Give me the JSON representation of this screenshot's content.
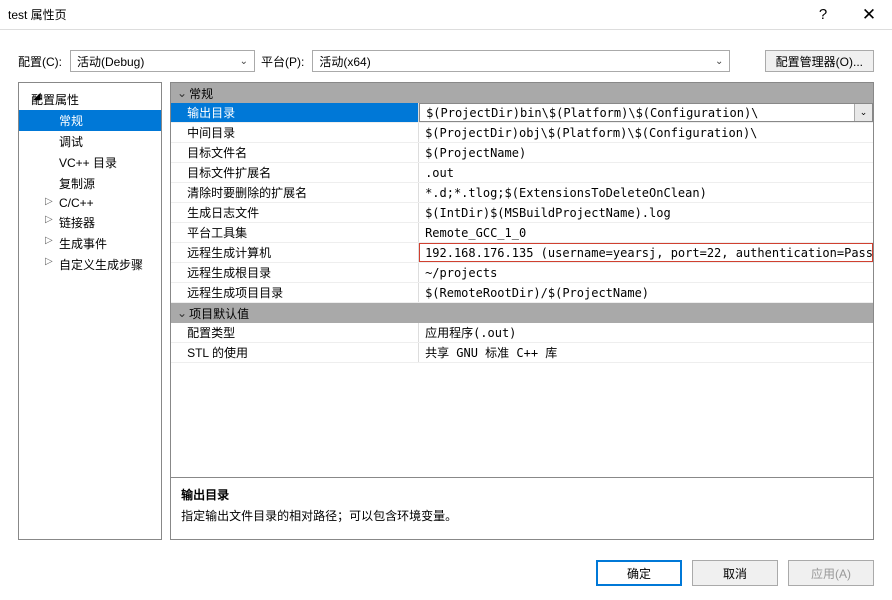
{
  "title": "test 属性页",
  "toprow": {
    "config_label": "配置(C):",
    "config_value": "活动(Debug)",
    "platform_label": "平台(P):",
    "platform_value": "活动(x64)",
    "config_mgr": "配置管理器(O)..."
  },
  "tree": [
    {
      "label": "配置属性",
      "level": 0,
      "arrow": "open"
    },
    {
      "label": "常规",
      "level": 1,
      "selected": true
    },
    {
      "label": "调试",
      "level": 1
    },
    {
      "label": "VC++ 目录",
      "level": 1
    },
    {
      "label": "复制源",
      "level": 1
    },
    {
      "label": "C/C++",
      "level": 1,
      "arrow": "closed"
    },
    {
      "label": "链接器",
      "level": 1,
      "arrow": "closed"
    },
    {
      "label": "生成事件",
      "level": 1,
      "arrow": "closed"
    },
    {
      "label": "自定义生成步骤",
      "level": 1,
      "arrow": "closed"
    }
  ],
  "grid": {
    "sections": [
      {
        "header": "常规",
        "rows": [
          {
            "name": "输出目录",
            "value": "$(ProjectDir)bin\\$(Platform)\\$(Configuration)\\",
            "hl": true
          },
          {
            "name": "中间目录",
            "value": "$(ProjectDir)obj\\$(Platform)\\$(Configuration)\\"
          },
          {
            "name": "目标文件名",
            "value": "$(ProjectName)"
          },
          {
            "name": "目标文件扩展名",
            "value": ".out"
          },
          {
            "name": "清除时要删除的扩展名",
            "value": "*.d;*.tlog;$(ExtensionsToDeleteOnClean)"
          },
          {
            "name": "生成日志文件",
            "value": "$(IntDir)$(MSBuildProjectName).log"
          },
          {
            "name": "平台工具集",
            "value": "Remote_GCC_1_0"
          },
          {
            "name": "远程生成计算机",
            "value": "192.168.176.135 (username=yearsj, port=22, authentication=Pass",
            "redbox": true
          },
          {
            "name": "远程生成根目录",
            "value": "~/projects"
          },
          {
            "name": "远程生成项目目录",
            "value": "$(RemoteRootDir)/$(ProjectName)"
          }
        ]
      },
      {
        "header": "项目默认值",
        "rows": [
          {
            "name": "配置类型",
            "value": "应用程序(.out)"
          },
          {
            "name": "STL 的使用",
            "value": "共享 GNU 标准 C++ 库"
          }
        ]
      }
    ]
  },
  "desc": {
    "title": "输出目录",
    "text": "指定输出文件目录的相对路径；可以包含环境变量。"
  },
  "buttons": {
    "ok": "确定",
    "cancel": "取消",
    "apply": "应用(A)"
  }
}
